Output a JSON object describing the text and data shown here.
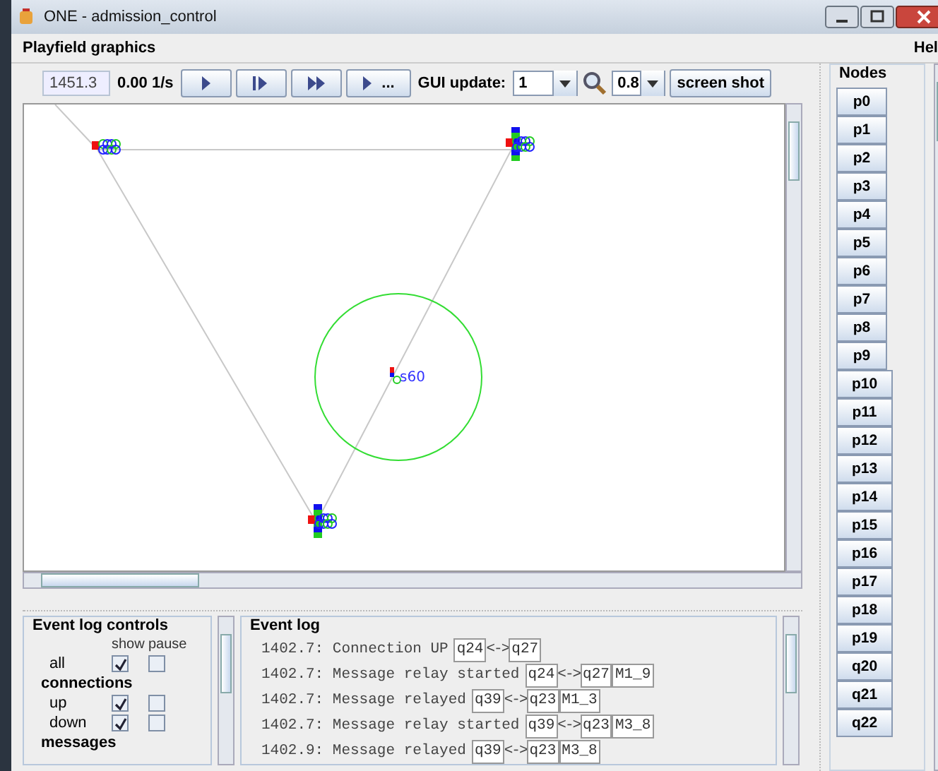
{
  "window": {
    "title": "ONE - admission_control"
  },
  "menu": [
    {
      "label": "Playfield graphics"
    },
    {
      "label": "Hel"
    }
  ],
  "toolbar": {
    "sim_time": "1451.3",
    "speed": "0.00 1/s",
    "controls": [
      {
        "kind": "play"
      },
      {
        "kind": "step"
      },
      {
        "kind": "fast"
      },
      {
        "kind": "play",
        "label": "..."
      }
    ],
    "gui_update_label": "GUI update:",
    "gui_update_value": "1",
    "zoom_value": "0.8",
    "screenshot": "screen shot"
  },
  "playfield": {
    "labels": [
      {
        "text": "s60"
      }
    ]
  },
  "event_log_controls": {
    "title": "Event log controls",
    "columns": [
      "show",
      "pause"
    ],
    "rows": [
      {
        "kind": "option",
        "label": "all",
        "show": true,
        "pause": false
      },
      {
        "kind": "heading",
        "label": "connections"
      },
      {
        "kind": "option",
        "label": "up",
        "show": true,
        "pause": false
      },
      {
        "kind": "option",
        "label": "down",
        "show": true,
        "pause": false
      },
      {
        "kind": "heading",
        "label": "messages"
      }
    ]
  },
  "event_log": {
    "title": "Event log",
    "entries": [
      {
        "text": "1402.7: Connection UP",
        "from": "q24",
        "link": "<->",
        "to": "q27"
      },
      {
        "text": "1402.7: Message relay started",
        "from": "q24",
        "link": "<->",
        "to": "q27",
        "message": "M1_9"
      },
      {
        "text": "1402.7: Message relayed",
        "from": "q39",
        "link": "<->",
        "to": "q23",
        "message": "M1_3"
      },
      {
        "text": "1402.7: Message relay started",
        "from": "q39",
        "link": "<->",
        "to": "q23",
        "message": "M3_8"
      },
      {
        "text": "1402.9: Message relayed",
        "from": "q39",
        "link": "<->",
        "to": "q23",
        "message": "M3_8"
      }
    ]
  },
  "nodes": {
    "title": "Nodes",
    "items": [
      "p0",
      "p1",
      "p2",
      "p3",
      "p4",
      "p5",
      "p6",
      "p7",
      "p8",
      "p9",
      "p10",
      "p11",
      "p12",
      "p13",
      "p14",
      "p15",
      "p16",
      "p17",
      "p18",
      "p19",
      "q20",
      "q21",
      "q22"
    ]
  }
}
